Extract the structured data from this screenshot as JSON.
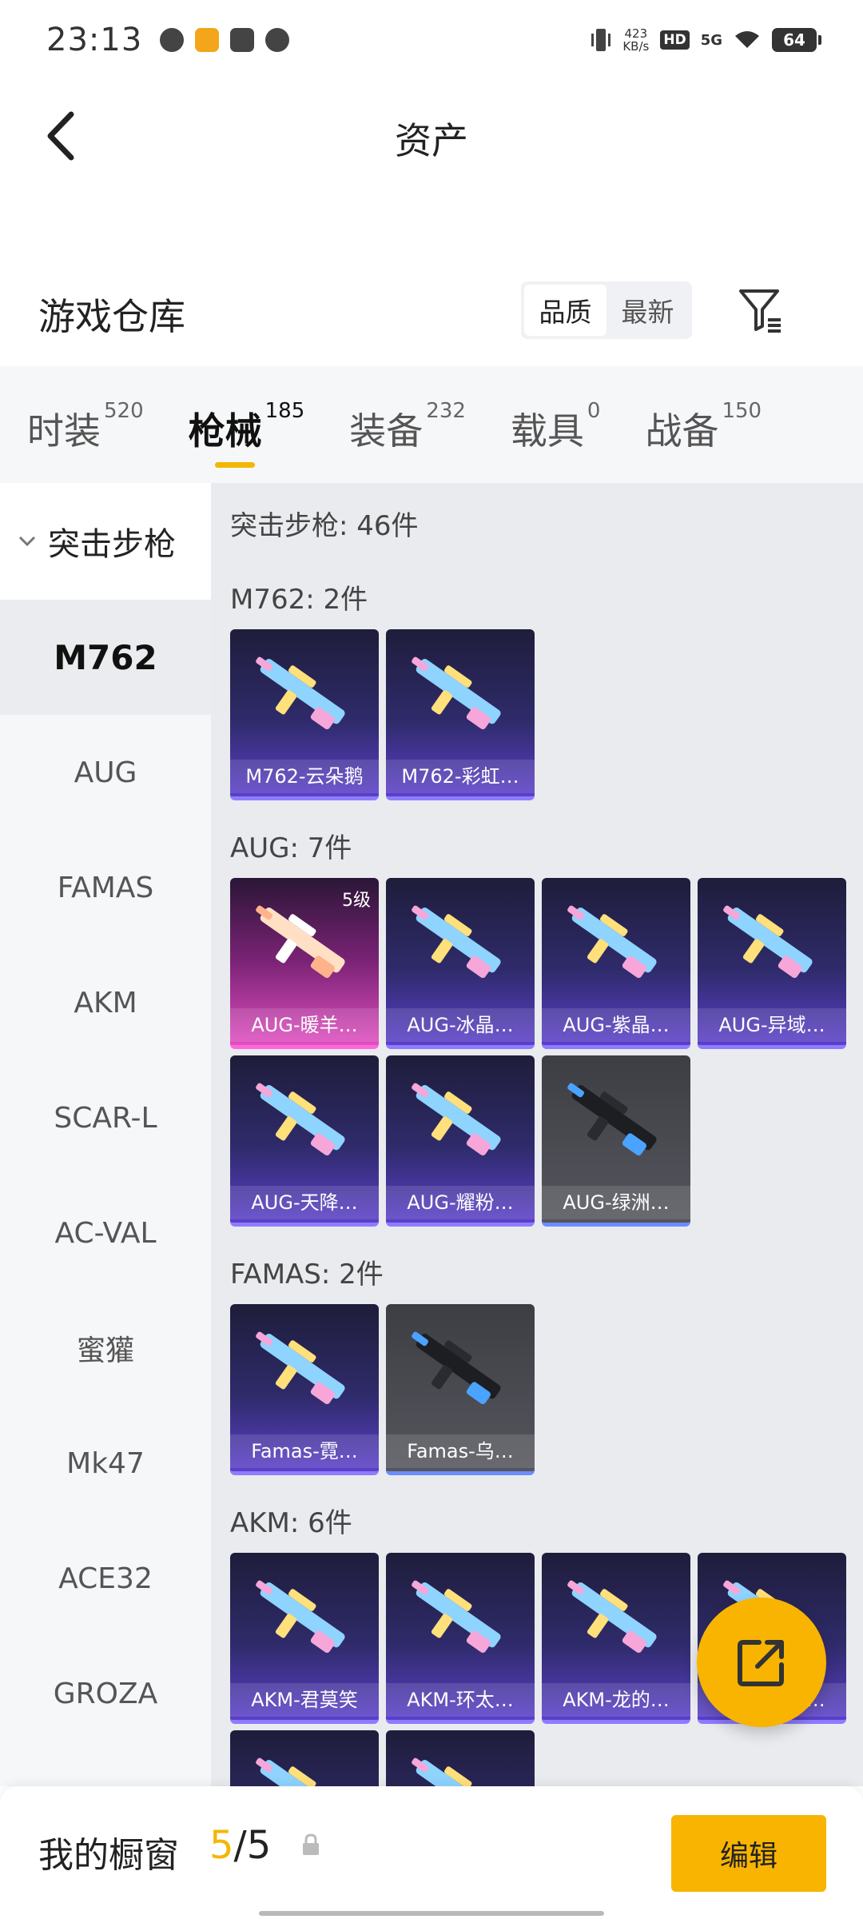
{
  "status_bar": {
    "time": "23:13",
    "net_speed_value": "423",
    "net_speed_unit": "KB/s",
    "hd": "HD",
    "network": "5G",
    "battery": "64"
  },
  "nav": {
    "title": "资产",
    "back_icon": "chevron-left-icon"
  },
  "warehouse": {
    "title": "游戏仓库",
    "sort_options": [
      "品质",
      "最新"
    ],
    "sort_selected": "品质",
    "filter_icon": "filter-icon"
  },
  "tabs": [
    {
      "label": "时装",
      "count": "520",
      "active": false
    },
    {
      "label": "枪械",
      "count": "185",
      "active": true
    },
    {
      "label": "装备",
      "count": "232",
      "active": false
    },
    {
      "label": "载具",
      "count": "0",
      "active": false
    },
    {
      "label": "战备",
      "count": "150",
      "active": false
    }
  ],
  "sidebar": {
    "group": "突击步枪",
    "items": [
      "M762",
      "AUG",
      "FAMAS",
      "AKM",
      "SCAR-L",
      "AC-VAL",
      "蜜獾",
      "Mk47",
      "ACE32",
      "GROZA"
    ],
    "active": "M762"
  },
  "content": {
    "heading": "突击步枪: 46件",
    "sections": [
      {
        "title": "M762: 2件",
        "items": [
          {
            "name": "M762-云朵鹅",
            "style": "purple"
          },
          {
            "name": "M762-彩虹…",
            "style": "purple"
          }
        ]
      },
      {
        "title": "AUG: 7件",
        "items": [
          {
            "name": "AUG-暖羊…",
            "style": "pink",
            "level": "5级"
          },
          {
            "name": "AUG-冰晶…",
            "style": "purple"
          },
          {
            "name": "AUG-紫晶…",
            "style": "purple"
          },
          {
            "name": "AUG-异域…",
            "style": "purple"
          },
          {
            "name": "AUG-天降…",
            "style": "purple"
          },
          {
            "name": "AUG-耀粉…",
            "style": "purple"
          },
          {
            "name": "AUG-绿洲…",
            "style": "gray"
          }
        ]
      },
      {
        "title": "FAMAS: 2件",
        "items": [
          {
            "name": "Famas-霓…",
            "style": "purple"
          },
          {
            "name": "Famas-乌…",
            "style": "gray"
          }
        ]
      },
      {
        "title": "AKM: 6件",
        "items": [
          {
            "name": "AKM-君莫笑",
            "style": "purple"
          },
          {
            "name": "AKM-环太…",
            "style": "purple"
          },
          {
            "name": "AKM-龙的…",
            "style": "purple"
          },
          {
            "name": "AKM-…彩…",
            "style": "purple"
          },
          {
            "name": "",
            "style": "purple"
          },
          {
            "name": "",
            "style": "purple"
          }
        ]
      }
    ]
  },
  "fab": {
    "icon": "share-icon"
  },
  "bottom_bar": {
    "label": "我的橱窗",
    "current": "5",
    "separator": "/",
    "total": "5",
    "lock_icon": "lock-icon",
    "edit_label": "编辑"
  },
  "colors": {
    "accent": "#f8b400",
    "card_purple": "#5b3fc9",
    "card_pink": "#e04ec0",
    "card_gray": "#55565d"
  }
}
